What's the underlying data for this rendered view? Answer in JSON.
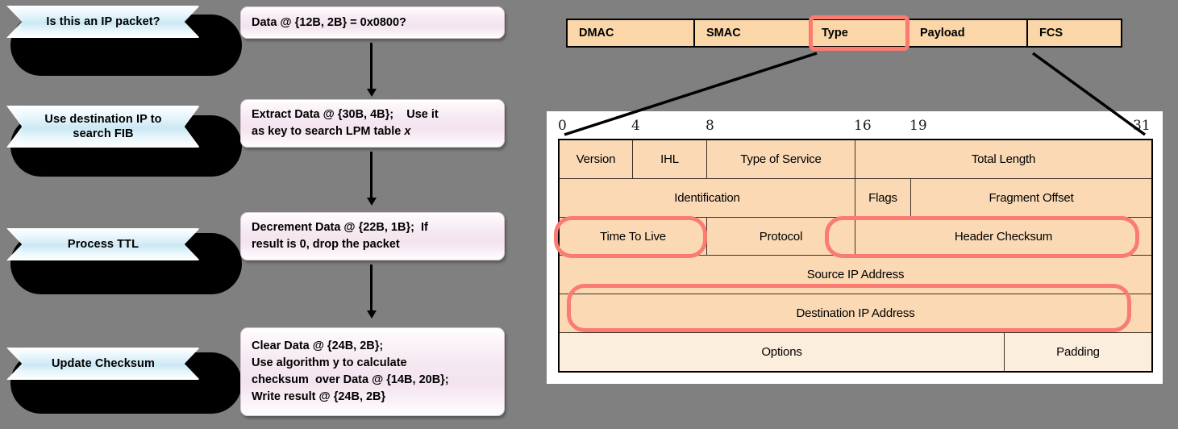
{
  "background_color": "#808080",
  "flowchart": {
    "steps": [
      {
        "label": "Is this an IP packet?",
        "action_lines": [
          "Data @ {12B, 2B} = 0x0800?"
        ]
      },
      {
        "label": "Use destination IP to search FIB",
        "action_lines": [
          "Extract Data @ {30B, 4B};    Use it",
          "as key to search LPM table "
        ],
        "action_italic_tail": "x"
      },
      {
        "label": "Process TTL",
        "action_lines": [
          "Decrement Data @ {22B, 1B};  If",
          "result is 0, drop the packet"
        ]
      },
      {
        "label": "Update Checksum",
        "action_lines": [
          "Clear Data @ {24B, 2B};",
          "Use algorithm y to calculate",
          "checksum  over Data @ {14B, 20B};",
          "Write result @ {24B, 2B}"
        ]
      }
    ]
  },
  "ethernet_frame": {
    "fields": [
      "DMAC",
      "SMAC",
      "Type",
      "Payload",
      "FCS"
    ],
    "highlighted_field": "Type",
    "highlight_color": "#fa7b72",
    "cell_color": "#fad6a8"
  },
  "ip_header": {
    "bit_ruler": [
      "0",
      "4",
      "8",
      "16",
      "19",
      "31"
    ],
    "rows": [
      [
        "Version",
        "IHL",
        "Type of Service",
        "Total Length"
      ],
      [
        "Identification",
        "Flags",
        "Fragment Offset"
      ],
      [
        "Time To Live",
        "Protocol",
        "Header Checksum"
      ],
      [
        "Source IP Address"
      ],
      [
        "Destination IP Address"
      ],
      [
        "Options",
        "Padding"
      ]
    ],
    "highlighted_fields": [
      "Time To Live",
      "Header Checksum",
      "Destination IP Address"
    ],
    "cell_color": "#fad9b4",
    "options_row_color": "#fbeedd",
    "panel_color": "#ffffff"
  }
}
